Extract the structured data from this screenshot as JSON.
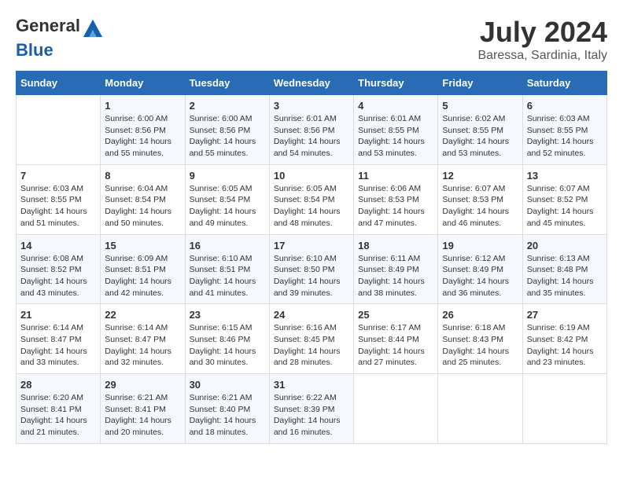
{
  "header": {
    "logo_general": "General",
    "logo_blue": "Blue",
    "title": "July 2024",
    "subtitle": "Baressa, Sardinia, Italy"
  },
  "days_of_week": [
    "Sunday",
    "Monday",
    "Tuesday",
    "Wednesday",
    "Thursday",
    "Friday",
    "Saturday"
  ],
  "weeks": [
    [
      {
        "day": "",
        "sunrise": "",
        "sunset": "",
        "daylight": ""
      },
      {
        "day": "1",
        "sunrise": "Sunrise: 6:00 AM",
        "sunset": "Sunset: 8:56 PM",
        "daylight": "Daylight: 14 hours and 55 minutes."
      },
      {
        "day": "2",
        "sunrise": "Sunrise: 6:00 AM",
        "sunset": "Sunset: 8:56 PM",
        "daylight": "Daylight: 14 hours and 55 minutes."
      },
      {
        "day": "3",
        "sunrise": "Sunrise: 6:01 AM",
        "sunset": "Sunset: 8:56 PM",
        "daylight": "Daylight: 14 hours and 54 minutes."
      },
      {
        "day": "4",
        "sunrise": "Sunrise: 6:01 AM",
        "sunset": "Sunset: 8:55 PM",
        "daylight": "Daylight: 14 hours and 53 minutes."
      },
      {
        "day": "5",
        "sunrise": "Sunrise: 6:02 AM",
        "sunset": "Sunset: 8:55 PM",
        "daylight": "Daylight: 14 hours and 53 minutes."
      },
      {
        "day": "6",
        "sunrise": "Sunrise: 6:03 AM",
        "sunset": "Sunset: 8:55 PM",
        "daylight": "Daylight: 14 hours and 52 minutes."
      }
    ],
    [
      {
        "day": "7",
        "sunrise": "Sunrise: 6:03 AM",
        "sunset": "Sunset: 8:55 PM",
        "daylight": "Daylight: 14 hours and 51 minutes."
      },
      {
        "day": "8",
        "sunrise": "Sunrise: 6:04 AM",
        "sunset": "Sunset: 8:54 PM",
        "daylight": "Daylight: 14 hours and 50 minutes."
      },
      {
        "day": "9",
        "sunrise": "Sunrise: 6:05 AM",
        "sunset": "Sunset: 8:54 PM",
        "daylight": "Daylight: 14 hours and 49 minutes."
      },
      {
        "day": "10",
        "sunrise": "Sunrise: 6:05 AM",
        "sunset": "Sunset: 8:54 PM",
        "daylight": "Daylight: 14 hours and 48 minutes."
      },
      {
        "day": "11",
        "sunrise": "Sunrise: 6:06 AM",
        "sunset": "Sunset: 8:53 PM",
        "daylight": "Daylight: 14 hours and 47 minutes."
      },
      {
        "day": "12",
        "sunrise": "Sunrise: 6:07 AM",
        "sunset": "Sunset: 8:53 PM",
        "daylight": "Daylight: 14 hours and 46 minutes."
      },
      {
        "day": "13",
        "sunrise": "Sunrise: 6:07 AM",
        "sunset": "Sunset: 8:52 PM",
        "daylight": "Daylight: 14 hours and 45 minutes."
      }
    ],
    [
      {
        "day": "14",
        "sunrise": "Sunrise: 6:08 AM",
        "sunset": "Sunset: 8:52 PM",
        "daylight": "Daylight: 14 hours and 43 minutes."
      },
      {
        "day": "15",
        "sunrise": "Sunrise: 6:09 AM",
        "sunset": "Sunset: 8:51 PM",
        "daylight": "Daylight: 14 hours and 42 minutes."
      },
      {
        "day": "16",
        "sunrise": "Sunrise: 6:10 AM",
        "sunset": "Sunset: 8:51 PM",
        "daylight": "Daylight: 14 hours and 41 minutes."
      },
      {
        "day": "17",
        "sunrise": "Sunrise: 6:10 AM",
        "sunset": "Sunset: 8:50 PM",
        "daylight": "Daylight: 14 hours and 39 minutes."
      },
      {
        "day": "18",
        "sunrise": "Sunrise: 6:11 AM",
        "sunset": "Sunset: 8:49 PM",
        "daylight": "Daylight: 14 hours and 38 minutes."
      },
      {
        "day": "19",
        "sunrise": "Sunrise: 6:12 AM",
        "sunset": "Sunset: 8:49 PM",
        "daylight": "Daylight: 14 hours and 36 minutes."
      },
      {
        "day": "20",
        "sunrise": "Sunrise: 6:13 AM",
        "sunset": "Sunset: 8:48 PM",
        "daylight": "Daylight: 14 hours and 35 minutes."
      }
    ],
    [
      {
        "day": "21",
        "sunrise": "Sunrise: 6:14 AM",
        "sunset": "Sunset: 8:47 PM",
        "daylight": "Daylight: 14 hours and 33 minutes."
      },
      {
        "day": "22",
        "sunrise": "Sunrise: 6:14 AM",
        "sunset": "Sunset: 8:47 PM",
        "daylight": "Daylight: 14 hours and 32 minutes."
      },
      {
        "day": "23",
        "sunrise": "Sunrise: 6:15 AM",
        "sunset": "Sunset: 8:46 PM",
        "daylight": "Daylight: 14 hours and 30 minutes."
      },
      {
        "day": "24",
        "sunrise": "Sunrise: 6:16 AM",
        "sunset": "Sunset: 8:45 PM",
        "daylight": "Daylight: 14 hours and 28 minutes."
      },
      {
        "day": "25",
        "sunrise": "Sunrise: 6:17 AM",
        "sunset": "Sunset: 8:44 PM",
        "daylight": "Daylight: 14 hours and 27 minutes."
      },
      {
        "day": "26",
        "sunrise": "Sunrise: 6:18 AM",
        "sunset": "Sunset: 8:43 PM",
        "daylight": "Daylight: 14 hours and 25 minutes."
      },
      {
        "day": "27",
        "sunrise": "Sunrise: 6:19 AM",
        "sunset": "Sunset: 8:42 PM",
        "daylight": "Daylight: 14 hours and 23 minutes."
      }
    ],
    [
      {
        "day": "28",
        "sunrise": "Sunrise: 6:20 AM",
        "sunset": "Sunset: 8:41 PM",
        "daylight": "Daylight: 14 hours and 21 minutes."
      },
      {
        "day": "29",
        "sunrise": "Sunrise: 6:21 AM",
        "sunset": "Sunset: 8:41 PM",
        "daylight": "Daylight: 14 hours and 20 minutes."
      },
      {
        "day": "30",
        "sunrise": "Sunrise: 6:21 AM",
        "sunset": "Sunset: 8:40 PM",
        "daylight": "Daylight: 14 hours and 18 minutes."
      },
      {
        "day": "31",
        "sunrise": "Sunrise: 6:22 AM",
        "sunset": "Sunset: 8:39 PM",
        "daylight": "Daylight: 14 hours and 16 minutes."
      },
      {
        "day": "",
        "sunrise": "",
        "sunset": "",
        "daylight": ""
      },
      {
        "day": "",
        "sunrise": "",
        "sunset": "",
        "daylight": ""
      },
      {
        "day": "",
        "sunrise": "",
        "sunset": "",
        "daylight": ""
      }
    ]
  ]
}
